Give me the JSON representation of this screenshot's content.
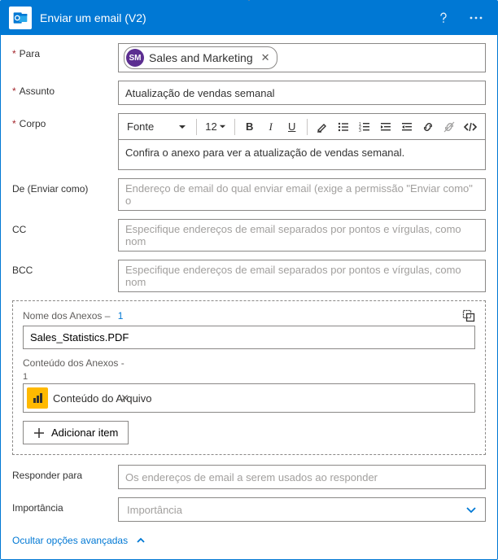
{
  "header": {
    "title": "Enviar um email (V2)"
  },
  "fields": {
    "to_label": "Para",
    "to_chip": {
      "initials": "SM",
      "name": "Sales and Marketing"
    },
    "subject_label": "Assunto",
    "subject_value": "Atualização de vendas semanal",
    "body_label": "Corpo",
    "body_content": "Confira o anexo para ver a atualização de vendas semanal.",
    "from_label": "De (Enviar como)",
    "from_placeholder": "Endereço de email do qual enviar email (exige a permissão \"Enviar como\" o",
    "cc_label": "CC",
    "cc_placeholder": "Especifique endereços de email separados por pontos e vírgulas, como nom",
    "bcc_label": "BCC",
    "bcc_placeholder": "Especifique endereços de email separados por pontos e vírgulas, como nom",
    "replyto_label": "Responder para",
    "replyto_placeholder": "Os endereços de email a serem usados ao responder",
    "importance_label": "Importância",
    "importance_placeholder": "Importância"
  },
  "toolbar": {
    "font_label": "Fonte",
    "size_label": "12"
  },
  "attachments": {
    "name_label": "Nome dos Anexos –",
    "name_count": "1",
    "name_value": "Sales_Statistics.PDF",
    "content_label": "Conteúdo dos Anexos  -",
    "content_count": "1",
    "token_label": "Conteúdo do Arquivo",
    "add_item": "Adicionar item"
  },
  "footer": {
    "hide_advanced": "Ocultar opções avançadas"
  }
}
